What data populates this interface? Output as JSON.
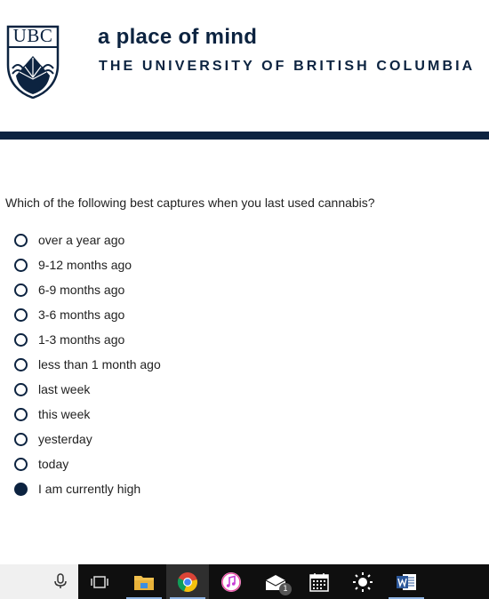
{
  "header": {
    "logo_text": "UBC",
    "tagline": "a place of mind",
    "university_name": "THE UNIVERSITY OF BRITISH COLUMBIA"
  },
  "survey": {
    "question": "Which of the following best captures when you last used cannabis?",
    "options": [
      {
        "label": "over a year ago",
        "selected": false
      },
      {
        "label": "9-12 months ago",
        "selected": false
      },
      {
        "label": "6-9 months ago",
        "selected": false
      },
      {
        "label": "3-6 months ago",
        "selected": false
      },
      {
        "label": "1-3 months ago",
        "selected": false
      },
      {
        "label": "less than 1 month ago",
        "selected": false
      },
      {
        "label": "last week",
        "selected": false
      },
      {
        "label": "this week",
        "selected": false
      },
      {
        "label": "yesterday",
        "selected": false
      },
      {
        "label": "today",
        "selected": false
      },
      {
        "label": "I am currently high",
        "selected": true
      }
    ]
  },
  "taskbar": {
    "icons": [
      "microphone-icon",
      "task-view-icon",
      "file-explorer-icon",
      "chrome-icon",
      "itunes-icon",
      "mail-icon",
      "calendar-icon",
      "weather-icon",
      "word-icon"
    ],
    "mail_badge": "1"
  },
  "colors": {
    "brand_navy": "#0c2340",
    "taskbar_bg": "#0f0f0f"
  }
}
